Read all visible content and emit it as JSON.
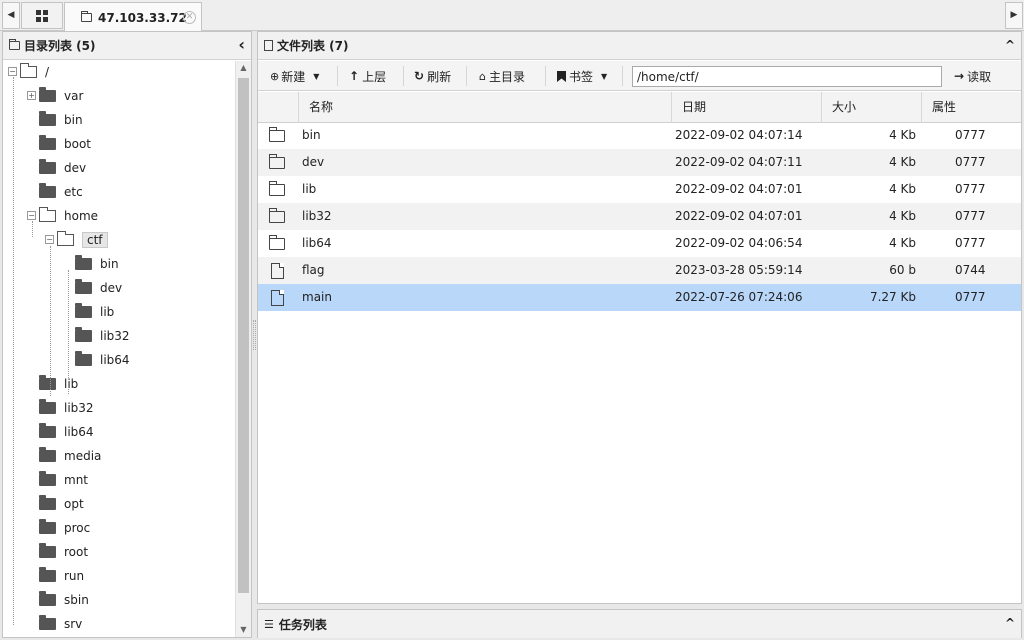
{
  "tabs": {
    "scroll_left": "◀",
    "scroll_right": "▶",
    "active_tab_label": "47.103.33.72",
    "close_glyph": "✕"
  },
  "dir_panel": {
    "title": "目录列表 (5)",
    "collapse_glyph": "‹",
    "tree": [
      {
        "label": "/",
        "level": 0,
        "expander": "−",
        "state": "open"
      },
      {
        "label": "var",
        "level": 1,
        "expander": "+",
        "state": "closed"
      },
      {
        "label": "bin",
        "level": 1,
        "state": "closed"
      },
      {
        "label": "boot",
        "level": 1,
        "state": "closed"
      },
      {
        "label": "dev",
        "level": 1,
        "state": "closed"
      },
      {
        "label": "etc",
        "level": 1,
        "state": "closed"
      },
      {
        "label": "home",
        "level": 1,
        "expander": "−",
        "state": "open"
      },
      {
        "label": "ctf",
        "level": 2,
        "expander": "−",
        "state": "open",
        "selected": true
      },
      {
        "label": "bin",
        "level": 3,
        "state": "closed"
      },
      {
        "label": "dev",
        "level": 3,
        "state": "closed"
      },
      {
        "label": "lib",
        "level": 3,
        "state": "closed"
      },
      {
        "label": "lib32",
        "level": 3,
        "state": "closed"
      },
      {
        "label": "lib64",
        "level": 3,
        "state": "closed"
      },
      {
        "label": "lib",
        "level": 1,
        "state": "closed"
      },
      {
        "label": "lib32",
        "level": 1,
        "state": "closed"
      },
      {
        "label": "lib64",
        "level": 1,
        "state": "closed"
      },
      {
        "label": "media",
        "level": 1,
        "state": "closed"
      },
      {
        "label": "mnt",
        "level": 1,
        "state": "closed"
      },
      {
        "label": "opt",
        "level": 1,
        "state": "closed"
      },
      {
        "label": "proc",
        "level": 1,
        "state": "closed"
      },
      {
        "label": "root",
        "level": 1,
        "state": "closed"
      },
      {
        "label": "run",
        "level": 1,
        "state": "closed"
      },
      {
        "label": "sbin",
        "level": 1,
        "state": "closed"
      },
      {
        "label": "srv",
        "level": 1,
        "state": "closed"
      }
    ]
  },
  "file_panel": {
    "title": "文件列表 (7)",
    "collapse_glyph": "^",
    "toolbar": {
      "new_label": "新建",
      "up_label": "上层",
      "refresh_label": "刷新",
      "home_label": "主目录",
      "bookmark_label": "书签",
      "path_value": "/home/ctf/",
      "read_label": "读取"
    },
    "columns": [
      "名称",
      "日期",
      "大小",
      "属性"
    ],
    "rows": [
      {
        "name": "bin",
        "date": "2022-09-02 04:07:14",
        "size": "4 Kb",
        "perm": "0777",
        "kind": "folder"
      },
      {
        "name": "dev",
        "date": "2022-09-02 04:07:11",
        "size": "4 Kb",
        "perm": "0777",
        "kind": "folder"
      },
      {
        "name": "lib",
        "date": "2022-09-02 04:07:01",
        "size": "4 Kb",
        "perm": "0777",
        "kind": "folder"
      },
      {
        "name": "lib32",
        "date": "2022-09-02 04:07:01",
        "size": "4 Kb",
        "perm": "0777",
        "kind": "folder"
      },
      {
        "name": "lib64",
        "date": "2022-09-02 04:06:54",
        "size": "4 Kb",
        "perm": "0777",
        "kind": "folder"
      },
      {
        "name": "flag",
        "date": "2023-03-28 05:59:14",
        "size": "60 b",
        "perm": "0744",
        "kind": "file"
      },
      {
        "name": "main",
        "date": "2022-07-26 07:24:06",
        "size": "7.27 Kb",
        "perm": "0777",
        "kind": "file",
        "selected": true
      }
    ]
  },
  "task_panel": {
    "title": "任务列表",
    "collapse_glyph": "^"
  },
  "colors": {
    "selected_row": "#b9d7f9",
    "alt_row": "#f2f2f2",
    "header_bg": "#f1f1f1"
  }
}
